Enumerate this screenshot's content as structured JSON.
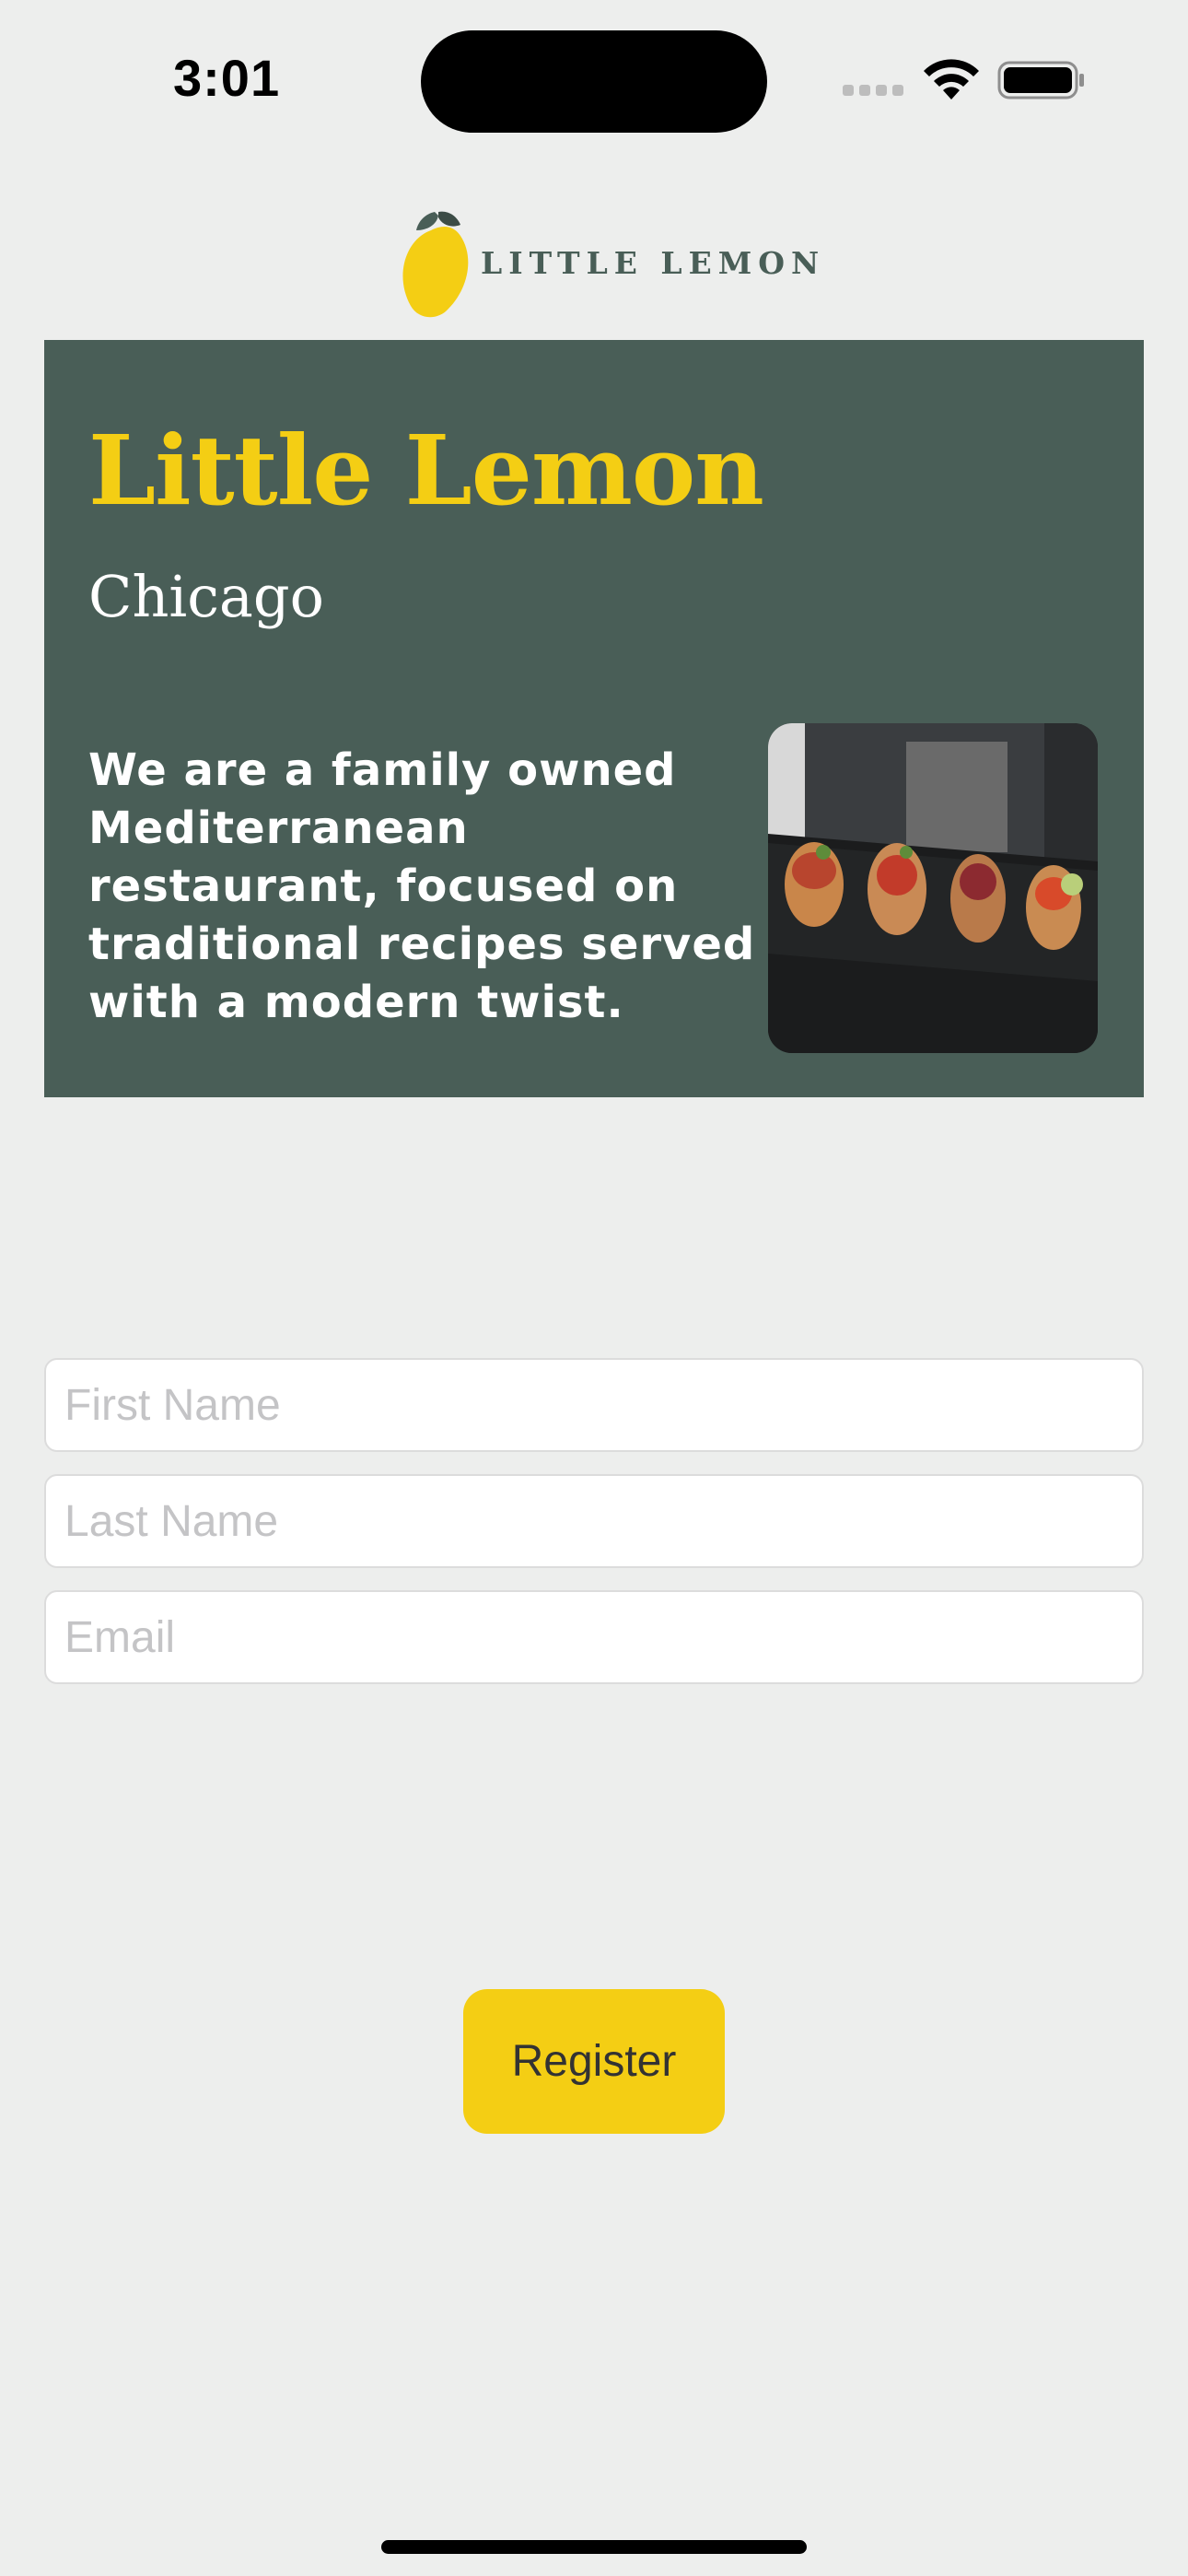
{
  "status_bar": {
    "time": "3:01"
  },
  "header": {
    "logo_text": "LITTLE LEMON",
    "logo_icon": "lemon-icon"
  },
  "hero": {
    "title": "Little Lemon",
    "subtitle": "Chicago",
    "description": "We are a family owned Mediterranean restaurant, focused on traditional recipes served with a modern twist.",
    "image_icon": "food-image"
  },
  "form": {
    "first_name_placeholder": "First Name",
    "last_name_placeholder": "Last Name",
    "email_placeholder": "Email",
    "first_name_value": "",
    "last_name_value": "",
    "email_value": ""
  },
  "register_button": {
    "label": "Register"
  },
  "colors": {
    "primary_green": "#495E57",
    "primary_yellow": "#F4CE14",
    "background": "#EDEEED"
  }
}
